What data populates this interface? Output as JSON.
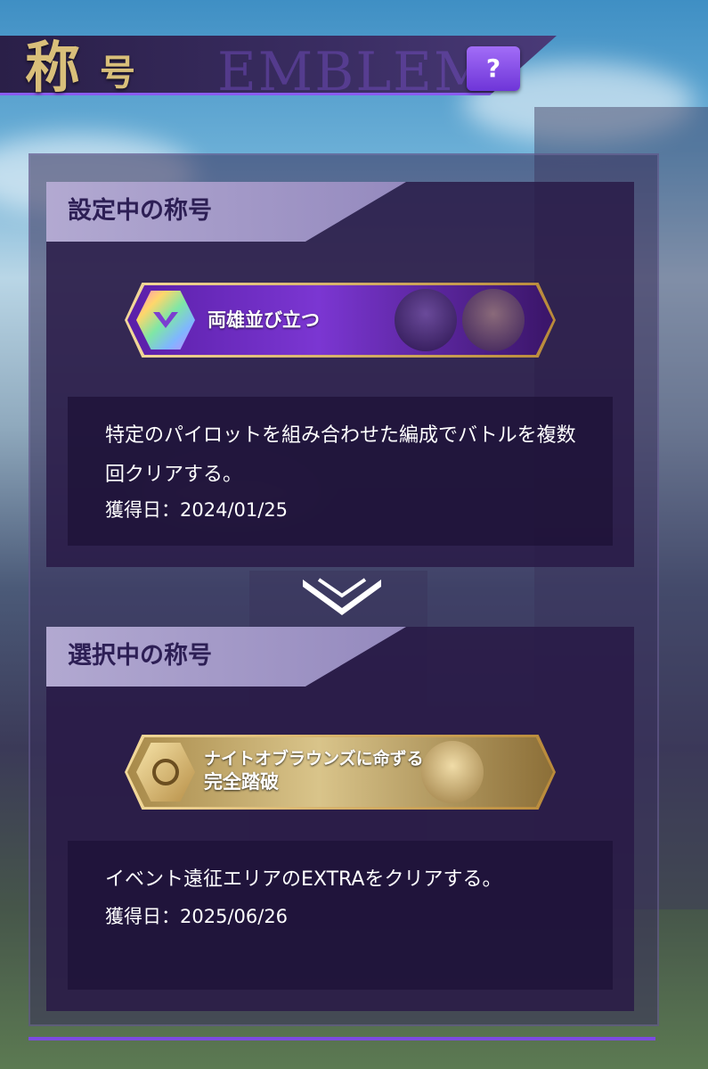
{
  "header": {
    "title_main": "称",
    "title_sub": "号",
    "title_en": "EMBLEM",
    "help_label": "?"
  },
  "current": {
    "section_title": "設定中の称号",
    "badge_label": "両雄並び立つ",
    "description": "特定のパイロットを組み合わせた編成でバトルを複数回クリアする。",
    "date": "獲得日：2024/01/25"
  },
  "selected": {
    "section_title": "選択中の称号",
    "badge_label_line1": "ナイトオブラウンズに命ずる",
    "badge_label_line2": "完全踏破",
    "description": "イベント遠征エリアのEXTRAをクリアする。",
    "date": "獲得日：2025/06/26"
  },
  "colors": {
    "accent": "#7c4be0",
    "gold": "#d9bf7a"
  }
}
